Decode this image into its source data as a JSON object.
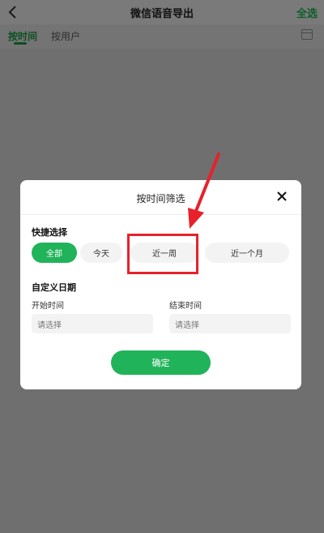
{
  "header": {
    "back_icon": "chevron-left-icon",
    "title": "微信语音导出",
    "select_all_label": "全选"
  },
  "tabs": [
    {
      "label": "按时间",
      "active": true
    },
    {
      "label": "按用户",
      "active": false
    }
  ],
  "calendar_icon": "calendar-icon",
  "dialog": {
    "title": "按时间筛选",
    "close_icon": "close-icon",
    "quick_select": {
      "title": "快捷选择",
      "options": [
        {
          "label": "全部",
          "selected": true
        },
        {
          "label": "今天",
          "selected": false
        },
        {
          "label": "近一周",
          "selected": false
        },
        {
          "label": "近一个月",
          "selected": false
        }
      ]
    },
    "custom_date": {
      "title": "自定义日期",
      "start": {
        "label": "开始时间",
        "placeholder": "请选择"
      },
      "end": {
        "label": "结束时间",
        "placeholder": "请选择"
      }
    },
    "confirm_label": "确定"
  },
  "colors": {
    "accent": "#21b35a",
    "annotation": "#e8212b",
    "overlay": "#6f6f6f"
  }
}
